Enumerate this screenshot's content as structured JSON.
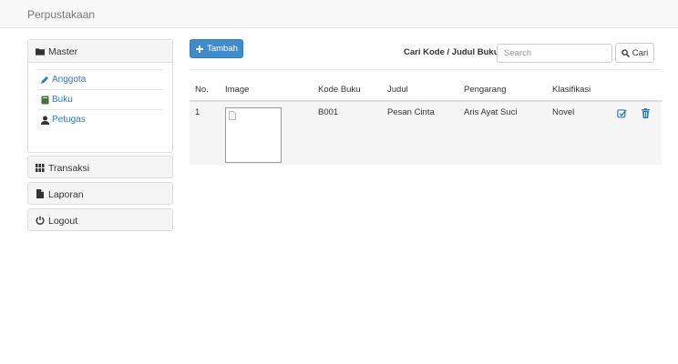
{
  "app": {
    "brand": "Perpustakaan"
  },
  "sidebar": {
    "master": {
      "label": "Master",
      "items": [
        {
          "label": "Anggota",
          "icon": "pencil-icon"
        },
        {
          "label": "Buku",
          "icon": "book-icon"
        },
        {
          "label": "Petugas",
          "icon": "user-icon"
        }
      ]
    },
    "transaksi": {
      "label": "Transaksi",
      "icon": "grid-icon"
    },
    "laporan": {
      "label": "Laporan",
      "icon": "file-icon"
    },
    "logout": {
      "label": "Logout",
      "icon": "power-icon"
    }
  },
  "toolbar": {
    "add_label": "Tambah",
    "search_label": "Cari Kode / Judul Buku",
    "search_placeholder": "Search",
    "search_value": "",
    "search_button": "Cari"
  },
  "table": {
    "headers": [
      "No.",
      "Image",
      "Kode Buku",
      "Judul",
      "Pengarang",
      "Klasifikasi"
    ],
    "rows": [
      {
        "no": "1",
        "kode": "B001",
        "judul": "Pesan Cinta",
        "pengarang": "Aris Ayat Suci",
        "klasifikasi": "Novel"
      }
    ]
  },
  "colors": {
    "primary": "#428bca",
    "link": "#337ab7",
    "navbar_bg": "#f8f8f8",
    "row_bg": "#f5f5f5"
  }
}
